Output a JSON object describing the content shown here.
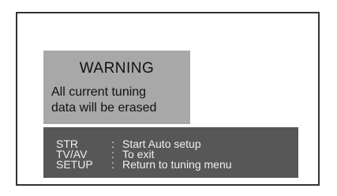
{
  "warning": {
    "title": "WARNING",
    "line1": "All current tuning",
    "line2": "data will be erased"
  },
  "menu": {
    "items": [
      {
        "key": "STR",
        "sep": ":",
        "desc": "Start Auto setup"
      },
      {
        "key": "TV/AV",
        "sep": ":",
        "desc": "To exit"
      },
      {
        "key": "SETUP",
        "sep": ":",
        "desc": "Return to tuning menu"
      }
    ]
  },
  "colors": {
    "warning_bg": "#a8a8a8",
    "menu_bg": "#575757",
    "frame": "#333333"
  }
}
